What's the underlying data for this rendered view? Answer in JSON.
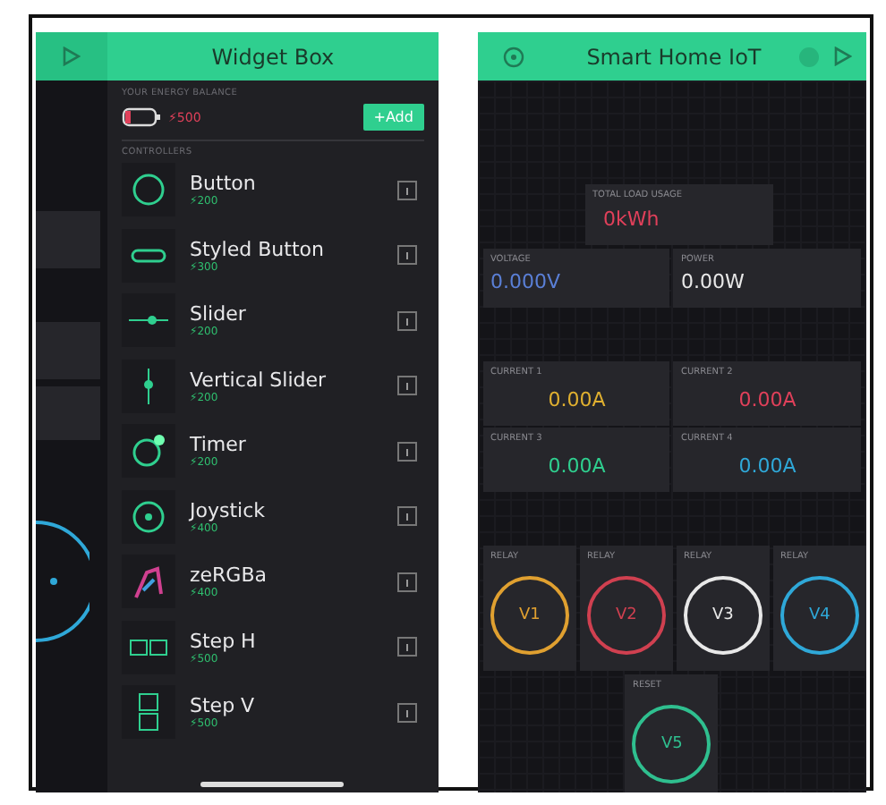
{
  "widget_box": {
    "title": "Widget Box",
    "balance_label": "YOUR ENERGY BALANCE",
    "balance": "⚡500",
    "add_button": "+Add",
    "section_label": "CONTROLLERS",
    "widgets": [
      {
        "kind": "button",
        "name": "Button",
        "cost": "⚡200"
      },
      {
        "kind": "styled",
        "name": "Styled Button",
        "cost": "⚡300"
      },
      {
        "kind": "slider",
        "name": "Slider",
        "cost": "⚡200"
      },
      {
        "kind": "vslider",
        "name": "Vertical Slider",
        "cost": "⚡200"
      },
      {
        "kind": "timer",
        "name": "Timer",
        "cost": "⚡200"
      },
      {
        "kind": "joystick",
        "name": "Joystick",
        "cost": "⚡400"
      },
      {
        "kind": "zergba",
        "name": "zeRGBa",
        "cost": "⚡400"
      },
      {
        "kind": "steph",
        "name": "Step H",
        "cost": "⚡500"
      },
      {
        "kind": "stepv",
        "name": "Step V",
        "cost": "⚡500"
      }
    ]
  },
  "dashboard": {
    "title": "Smart Home IoT",
    "total": {
      "label": "TOTAL LOAD USAGE",
      "value": "0kWh",
      "color": "#e0405a"
    },
    "meters": [
      {
        "label": "VOLTAGE",
        "value": "0.000V",
        "color": "#5a7fd6"
      },
      {
        "label": "POWER",
        "value": "0.00W",
        "color": "#e8e8e8"
      }
    ],
    "currents": [
      {
        "label": "CURRENT 1",
        "value": "0.00A",
        "color": "#e0b030"
      },
      {
        "label": "CURRENT 2",
        "value": "0.00A",
        "color": "#e0405a"
      },
      {
        "label": "CURRENT 3",
        "value": "0.00A",
        "color": "#2fcf8f"
      },
      {
        "label": "CURRENT 4",
        "value": "0.00A",
        "color": "#2fa8d8"
      }
    ],
    "relays": [
      {
        "label": "RELAY",
        "pin": "V1",
        "color": "#e0a030"
      },
      {
        "label": "RELAY",
        "pin": "V2",
        "color": "#d04050"
      },
      {
        "label": "RELAY",
        "pin": "V3",
        "color": "#e8e8e8"
      },
      {
        "label": "RELAY",
        "pin": "V4",
        "color": "#2fa8d8"
      }
    ],
    "reset": {
      "label": "RESET",
      "pin": "V5",
      "color": "#2fbf8f"
    }
  }
}
